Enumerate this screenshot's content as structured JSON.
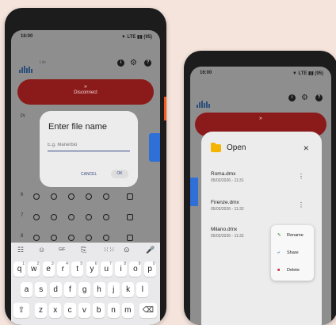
{
  "left": {
    "status_time": "16:00",
    "status_indicators": "▼ LTE ▮▮ (95)",
    "app_suffix": "Lite",
    "red_button": {
      "icon": "»",
      "label": "Disconnect"
    },
    "partial_label": "Pr",
    "dialog": {
      "title": "Enter file name",
      "placeholder": "E.g. Manerbio",
      "cancel": "CANCEL",
      "ok": "OK"
    },
    "rows": [
      "6",
      "7",
      "8"
    ],
    "toolbar": [
      "☷",
      "☺",
      "GIF",
      "⎘",
      "⁙⁙",
      "⊙",
      "🎤"
    ],
    "keys_row1": [
      "q",
      "w",
      "e",
      "r",
      "t",
      "y",
      "u",
      "i",
      "o",
      "p"
    ],
    "keys_row1_sup": [
      "1",
      "2",
      "3",
      "4",
      "5",
      "6",
      "7",
      "8",
      "9",
      "0"
    ],
    "keys_row2": [
      "a",
      "s",
      "d",
      "f",
      "g",
      "h",
      "j",
      "k",
      "l"
    ],
    "keys_row3": [
      "z",
      "x",
      "c",
      "v",
      "b",
      "n",
      "m"
    ],
    "shift_key": "⇧",
    "backspace_key": "⌫"
  },
  "right": {
    "status_time": "16:00",
    "status_indicators": "▼ LTE ▮▮ (95)",
    "red_partial": "»",
    "open_panel": {
      "title": "Open",
      "close": "✕",
      "files": [
        {
          "name": "Roma.dmx",
          "date": "05/02/2026 - 11:31"
        },
        {
          "name": "Firenze.dmx",
          "date": "05/02/2026 - 11:32"
        },
        {
          "name": "Milano.dmx",
          "date": "05/02/2026 - 11:32"
        }
      ],
      "kebab": "⋮",
      "menu": {
        "rename": "Rename",
        "share": "Share",
        "delete": "Delete"
      }
    }
  },
  "colors": {
    "background": "#f5e4dc",
    "accent_red": "#8b1b1a",
    "accent_blue": "#2f6fd8",
    "folder_yellow": "#f4b400"
  }
}
